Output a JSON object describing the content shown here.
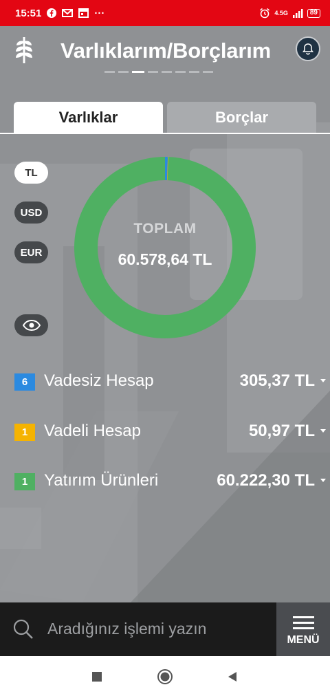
{
  "status_bar": {
    "time": "15:51",
    "more_indicator": "···",
    "network": "4.5G",
    "battery": "89",
    "icons": [
      "facebook-icon",
      "gmail-icon",
      "calendar-icon",
      "alarm-icon",
      "signal-icon",
      "battery-icon"
    ]
  },
  "header": {
    "title": "Varlıklarım/Borçlarım",
    "pager_count": 8,
    "pager_active_index": 2,
    "icons": [
      "wheat-logo-icon",
      "bell-icon"
    ]
  },
  "tabs": [
    {
      "label": "Varlıklar",
      "active": true
    },
    {
      "label": "Borçlar",
      "active": false
    }
  ],
  "currencies": [
    {
      "label": "TL",
      "selected": true
    },
    {
      "label": "USD",
      "selected": false
    },
    {
      "label": "EUR",
      "selected": false
    }
  ],
  "visibility_icon": "eye-icon",
  "summary": {
    "label": "TOPLAM",
    "value": "60.578,64 TL",
    "segments": [
      {
        "name": "Vadesiz Hesap",
        "amount": 305.37,
        "color": "#2b8ae0"
      },
      {
        "name": "Vadeli Hesap",
        "amount": 50.97,
        "color": "#f5b301"
      },
      {
        "name": "Yatırım Ürünleri",
        "amount": 60222.3,
        "color": "#4fb062"
      }
    ]
  },
  "assets": [
    {
      "count": "6",
      "name": "Vadesiz Hesap",
      "amount": "305,37 TL",
      "color": "#2b8ae0"
    },
    {
      "count": "1",
      "name": "Vadeli Hesap",
      "amount": "50,97 TL",
      "color": "#f5b301"
    },
    {
      "count": "1",
      "name": "Yatırım Ürünleri",
      "amount": "60.222,30 TL",
      "color": "#4fb062"
    }
  ],
  "search": {
    "placeholder": "Aradığınız işlemi yazın",
    "icon": "search-icon"
  },
  "menu": {
    "label": "MENÜ",
    "icon": "hamburger-icon"
  },
  "nav": [
    "recent-apps-icon",
    "home-icon",
    "back-icon"
  ],
  "colors": {
    "status_bar": "#e30613",
    "app_background": "#8f9194",
    "search_bar": "#1b1b1b",
    "menu_button": "#4a4c50"
  }
}
